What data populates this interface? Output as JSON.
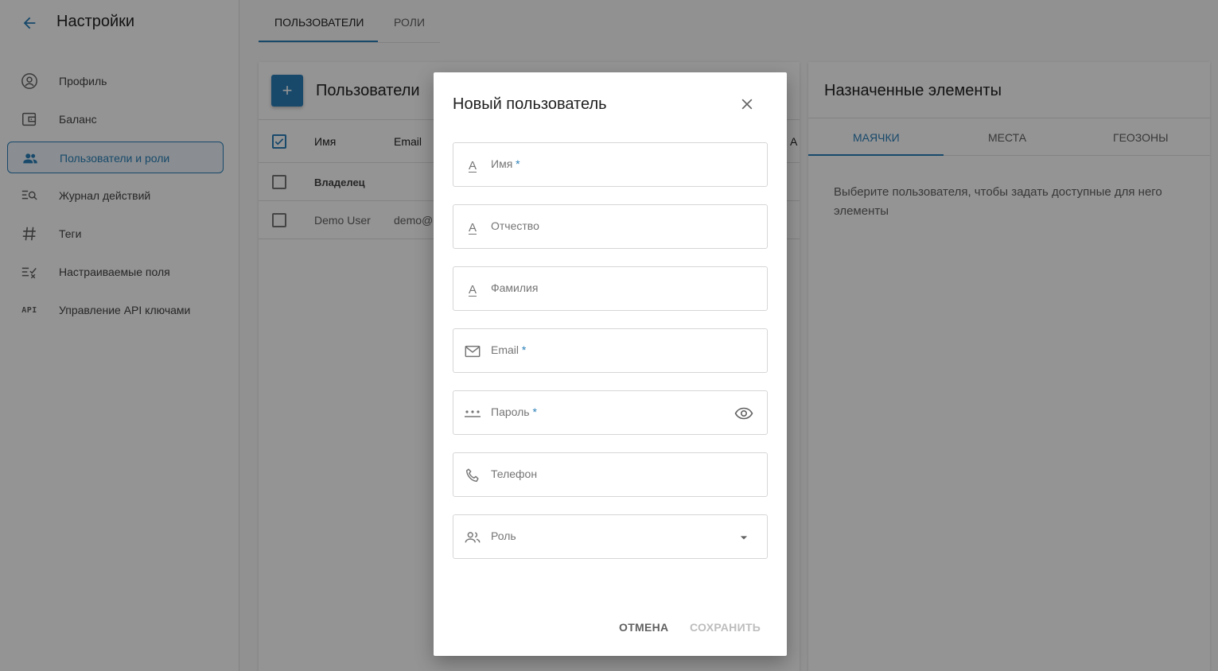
{
  "sidebar": {
    "title": "Настройки",
    "items": [
      {
        "label": "Профиль",
        "icon": "account-circle-icon"
      },
      {
        "label": "Баланс",
        "icon": "wallet-icon"
      },
      {
        "label": "Пользователи и роли",
        "icon": "users-icon",
        "active": true
      },
      {
        "label": "Журнал действий",
        "icon": "search-log-icon"
      },
      {
        "label": "Теги",
        "icon": "hash-icon"
      },
      {
        "label": "Настраиваемые поля",
        "icon": "custom-fields-icon"
      },
      {
        "label": "Управление API ключами",
        "icon": "api-icon",
        "icon_text": "API"
      }
    ]
  },
  "top_tabs": {
    "users": "ПОЛЬЗОВАТЕЛИ",
    "roles": "РОЛИ",
    "active": "users"
  },
  "users_card": {
    "add_label": "+",
    "title": "Пользователи",
    "columns": [
      "Имя",
      "Email",
      "А"
    ],
    "rows": [
      {
        "name": "Владелец",
        "email": ""
      },
      {
        "name": "Demo User",
        "email": "demo@"
      }
    ]
  },
  "assigned": {
    "title": "Назначенные элементы",
    "tabs": [
      "МАЯЧКИ",
      "МЕСТА",
      "ГЕОЗОНЫ"
    ],
    "active_tab": 0,
    "hint": "Выберите пользователя, чтобы задать доступные для него элементы"
  },
  "dialog": {
    "title": "Новый пользователь",
    "fields": {
      "first_name": {
        "label": "Имя",
        "required": "*"
      },
      "middle_name": {
        "label": "Отчество"
      },
      "last_name": {
        "label": "Фамилия"
      },
      "email": {
        "label": "Email",
        "required": "*"
      },
      "password": {
        "label": "Пароль",
        "required": "*"
      },
      "phone": {
        "label": "Телефон"
      },
      "role": {
        "label": "Роль"
      }
    },
    "cancel": "ОТМЕНА",
    "save": "СОХРАНИТЬ"
  },
  "colors": {
    "accent": "#2a7fb8",
    "overlay": "rgba(0,0,0,0.42)"
  }
}
